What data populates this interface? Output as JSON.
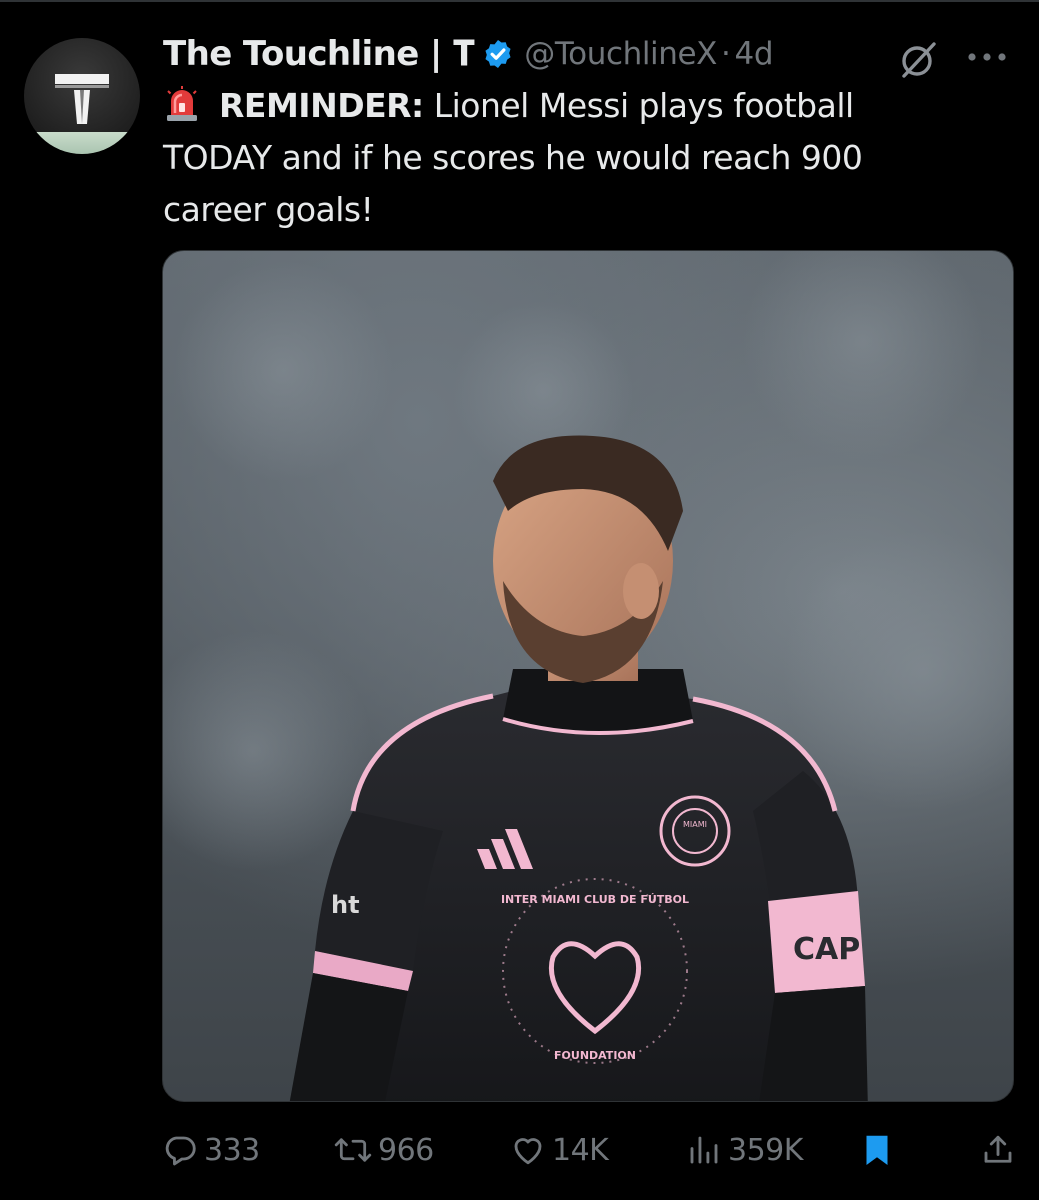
{
  "colors": {
    "background": "#000000",
    "text_primary": "#e7e9ea",
    "text_secondary": "#71767b",
    "verified_blue": "#1d9bf0",
    "bookmark_active": "#1d9bf0"
  },
  "post": {
    "author": {
      "display_name": "The Touchline | 𝐓",
      "handle": "@TouchlineX",
      "separator": "·",
      "time": "4d",
      "avatar_letter": "T",
      "verified_icon": "verified-badge-icon"
    },
    "text": {
      "emoji": "siren-emoji",
      "bold_lead": "REMINDER:",
      "line1_rest": " Lionel Messi plays football",
      "line2": "TODAY and if he scores he would reach 900",
      "line3": "career goals!"
    },
    "media": {
      "jersey_sponsor_fragment": "ht",
      "armband_text": "CAP",
      "crest_text": "MIAMI",
      "badge_text_top": "INTER MIAMI CLUB DE FÚTBOL",
      "badge_text_bottom": "FOUNDATION"
    },
    "stats": {
      "replies": "333",
      "reposts": "966",
      "likes": "14K",
      "views": "359K"
    }
  },
  "icons": {
    "grok": "grok-icon",
    "more": "more-dots-icon",
    "reply": "reply-bubble-icon",
    "repost": "repost-icon",
    "like": "heart-icon",
    "views": "views-chart-icon",
    "bookmark": "bookmark-icon",
    "share": "share-icon"
  }
}
